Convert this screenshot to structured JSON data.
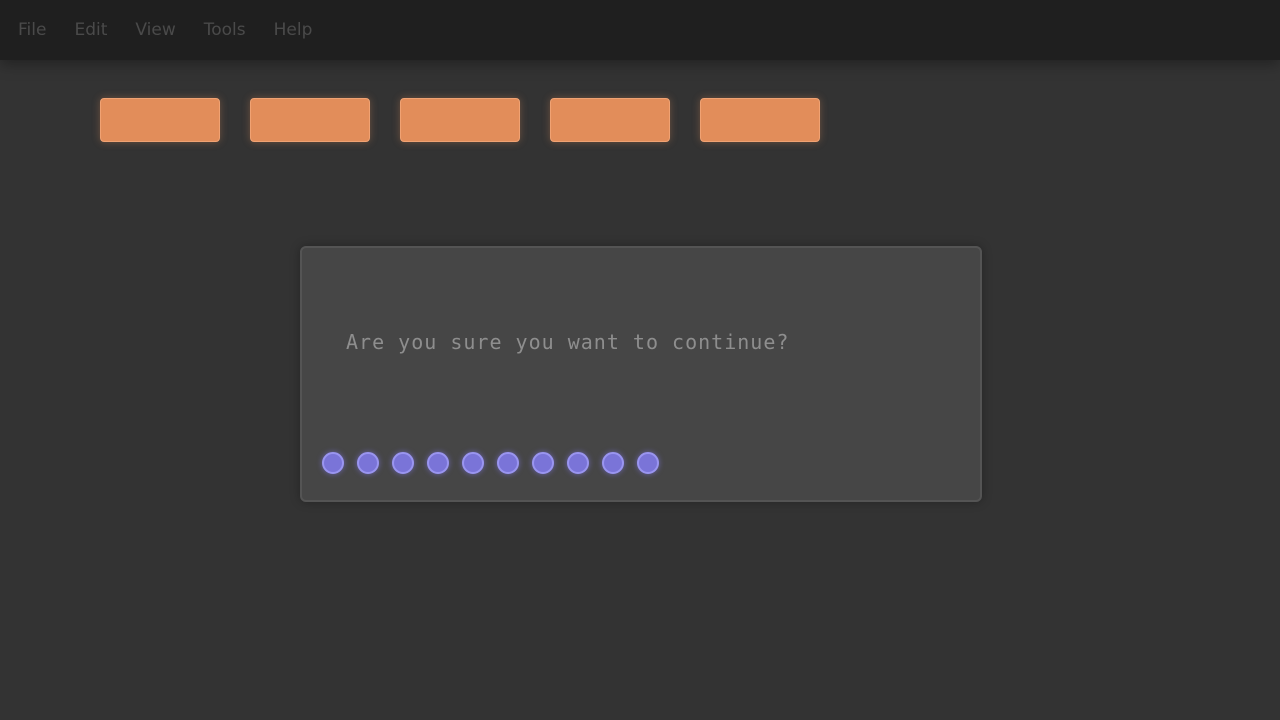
{
  "menubar": {
    "items": [
      {
        "label": "File"
      },
      {
        "label": "Edit"
      },
      {
        "label": "View"
      },
      {
        "label": "Tools"
      },
      {
        "label": "Help"
      }
    ]
  },
  "toolbar": {
    "buttons": [
      {
        "label": ""
      },
      {
        "label": ""
      },
      {
        "label": ""
      },
      {
        "label": ""
      },
      {
        "label": ""
      }
    ],
    "button_color": "#e28d5a"
  },
  "dialog": {
    "message": "Are you sure you want to continue?",
    "loading_indicator": {
      "dot_count": 10,
      "dot_color": "#7a74d8"
    }
  },
  "colors": {
    "background": "#333333",
    "menubar": "#1f1f1f",
    "dialog": "#464646"
  }
}
